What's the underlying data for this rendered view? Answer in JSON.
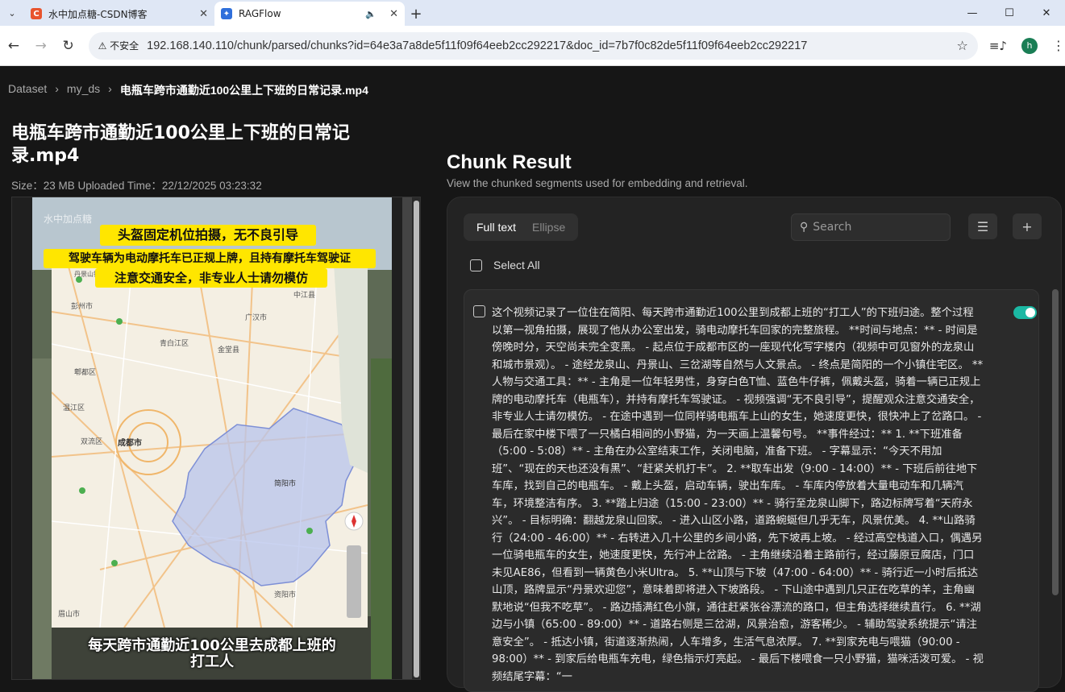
{
  "browser": {
    "tabs": [
      {
        "title": "水中加点糖-CSDN博客",
        "favicon": "C",
        "color": "#e8542e"
      },
      {
        "title": "RAGFlow",
        "favicon": "R",
        "color": "#2f6fdb"
      }
    ],
    "insecure_label": "不安全",
    "url": "192.168.140.110/chunk/parsed/chunks?id=64e3a7a8de5f11f09f64eeb2cc292217&doc_id=7b7f0c82de5f11f09f64eeb2cc292217",
    "profile_initial": "h"
  },
  "breadcrumb": {
    "items": [
      "Dataset",
      "my_ds",
      "电瓶车跨市通勤近100公里上下班的日常记录.mp4"
    ]
  },
  "document": {
    "title": "电瓶车跨市通勤近100公里上下班的日常记录.mp4",
    "meta": "Size：23 MB Uploaded Time：22/12/2025 03:23:32"
  },
  "video": {
    "watermark": "水中加点糖",
    "banner1": "头盔固定机位拍摄，无不良引导",
    "banner2": "驾驶车辆为电动摩托车已正规上牌，且持有摩托车驾驶证",
    "banner3": "注意交通安全，非专业人士请勿模仿",
    "caption1": "每天跨市通勤近100公里去成都上班的",
    "caption2": "打工人",
    "map_labels": [
      "彭州市",
      "青白江区",
      "金堂县",
      "郫都区",
      "温江区",
      "成都市",
      "双流区",
      "简阳市",
      "眉山市",
      "资阳市",
      "广汉市",
      "中江县",
      "丹景山镇"
    ]
  },
  "chunk": {
    "title": "Chunk Result",
    "subtitle": "View the chunked segments used for embedding and retrieval.",
    "tab_full": "Full text",
    "tab_ellipse": "Ellipse",
    "search_placeholder": "Search",
    "select_all": "Select All",
    "content": "这个视频记录了一位住在简阳、每天跨市通勤近100公里到成都上班的“打工人”的下班归途。整个过程以第一视角拍摄，展现了他从办公室出发，骑电动摩托车回家的完整旅程。 **时间与地点：** - 时间是傍晚时分，天空尚未完全变黑。 - 起点位于成都市区的一座现代化写字楼内（视频中可见窗外的龙泉山和城市景观）。 - 途经龙泉山、丹景山、三岔湖等自然与人文景点。 - 终点是简阳的一个小镇住宅区。 **人物与交通工具：** - 主角是一位年轻男性，身穿白色T恤、蓝色牛仔裤，佩戴头盔，骑着一辆已正规上牌的电动摩托车（电瓶车），并持有摩托车驾驶证。 - 视频强调“无不良引导”，提醒观众注意交通安全，非专业人士请勿模仿。 - 在途中遇到一位同样骑电瓶车上山的女生，她速度更快，很快冲上了岔路口。 - 最后在家中楼下喂了一只橘白相间的小野猫，为一天画上温馨句号。 **事件经过：** 1. **下班准备（5:00 - 5:08）** - 主角在办公室结束工作，关闭电脑，准备下班。 - 字幕显示：“今天不用加班”、“现在的天也还没有黑”、“赶紧关机打卡”。 2. **取车出发（9:00 - 14:00）** - 下班后前往地下车库，找到自己的电瓶车。 - 戴上头盔，启动车辆，驶出车库。 - 车库内停放着大量电动车和几辆汽车，环境整洁有序。 3. **踏上归途（15:00 - 23:00）** - 骑行至龙泉山脚下，路边标牌写着“天府永兴”。 - 目标明确：翻越龙泉山回家。 - 进入山区小路，道路蜿蜒但几乎无车，风景优美。 4. **山路骑行（24:00 - 46:00）** - 右转进入几十公里的乡间小路，先下坡再上坡。 - 经过高空栈道入口，偶遇另一位骑电瓶车的女生，她速度更快，先行冲上岔路。 - 主角继续沿着主路前行，经过藤原豆腐店，门口未见AE86，但看到一辆黄色小米Ultra。 5. **山顶与下坡（47:00 - 64:00）** - 骑行近一小时后抵达山顶，路牌显示“丹景欢迎您”，意味着即将进入下坡路段。 - 下山途中遇到几只正在吃草的羊，主角幽默地说“但我不吃草”。 - 路边插满红色小旗，通往赶紧张谷漂流的路口，但主角选择继续直行。 6. **湖边与小镇（65:00 - 89:00）** - 道路右侧是三岔湖，风景治愈，游客稀少。 - 辅助驾驶系统提示“请注意安全”。 - 抵达小镇，街道逐渐热闹，人车增多，生活气息浓厚。 7. **到家充电与喂猫（90:00 - 98:00）** - 到家后给电瓶车充电，绿色指示灯亮起。 - 最后下楼喂食一只小野猫，猫咪活泼可爱。 - 视频结尾字幕：“一"
  }
}
